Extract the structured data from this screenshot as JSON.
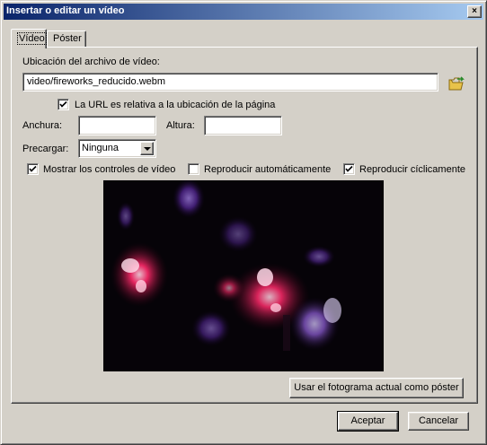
{
  "window": {
    "title": "Insertar o editar un vídeo",
    "close_glyph": "×"
  },
  "tabs": [
    {
      "label": "Vídeo"
    },
    {
      "label": "Póster"
    }
  ],
  "source": {
    "label": "Ubicación del archivo de vídeo:",
    "value": "video/fireworks_reducido.webm",
    "browse_icon": "folder-open-icon"
  },
  "relative_url": {
    "label": "La URL es relativa a la ubicación de la página",
    "checked": true
  },
  "size": {
    "width_label": "Anchura:",
    "width_value": "",
    "height_label": "Altura:",
    "height_value": ""
  },
  "preload": {
    "label": "Precargar:",
    "value": "Ninguna"
  },
  "options": [
    {
      "label": "Mostrar los controles de vídeo",
      "checked": true
    },
    {
      "label": "Reproducir automáticamente",
      "checked": false
    },
    {
      "label": "Reproducir cíclicamente",
      "checked": true
    }
  ],
  "poster_button": "Usar el fotograma actual como póster",
  "footer": {
    "accept": "Aceptar",
    "cancel": "Cancelar"
  },
  "colors": {
    "titlebar_start": "#0a246a",
    "titlebar_end": "#a6caf0",
    "face": "#d4d0c8"
  }
}
